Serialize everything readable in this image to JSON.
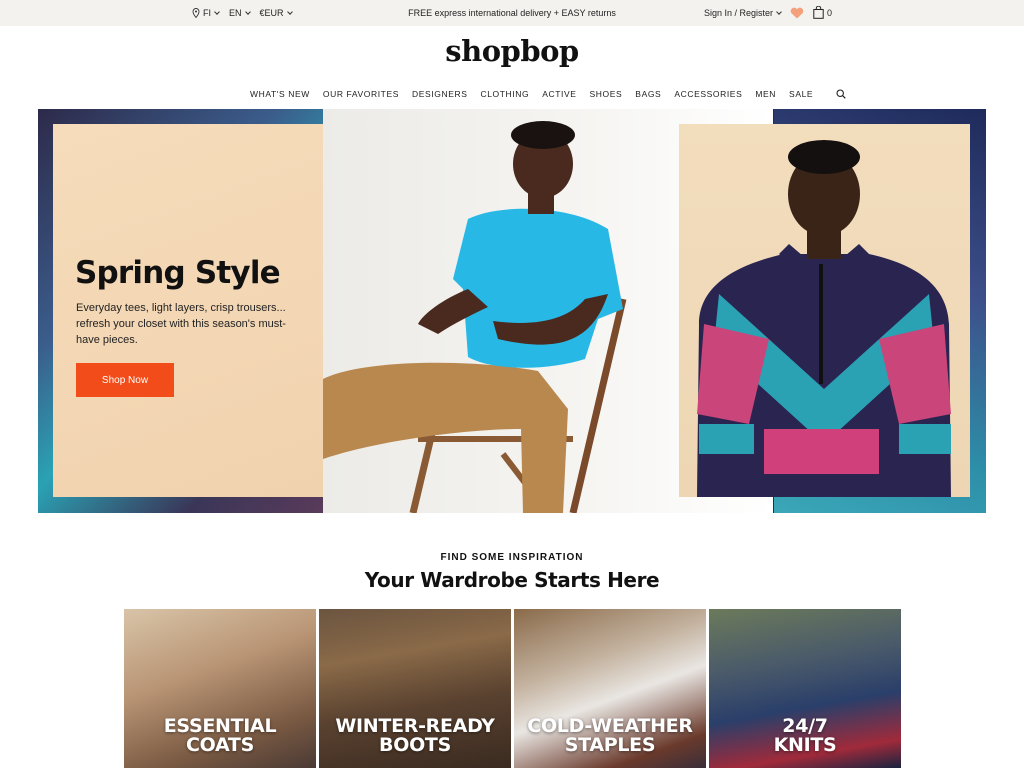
{
  "topbar": {
    "country": "FI",
    "language": "EN",
    "currency": "€EUR",
    "promo": "FREE express international delivery + EASY returns",
    "signin": "Sign In / Register",
    "bag_count": "0"
  },
  "logo": "shopbop",
  "nav": [
    "WHAT'S NEW",
    "OUR FAVORITES",
    "DESIGNERS",
    "CLOTHING",
    "ACTIVE",
    "SHOES",
    "BAGS",
    "ACCESSORIES",
    "MEN",
    "SALE"
  ],
  "hero": {
    "title": "Spring Style",
    "description": "Everyday tees, light layers, crisp trousers... refresh your closet with this season's must-have pieces.",
    "cta": "Shop Now"
  },
  "inspiration": {
    "eyebrow": "FIND SOME INSPIRATION",
    "title": "Your Wardrobe Starts Here"
  },
  "tiles": [
    {
      "line1": "ESSENTIAL",
      "line2": "COATS"
    },
    {
      "line1": "WINTER-READY",
      "line2": "BOOTS"
    },
    {
      "line1": "COLD-WEATHER",
      "line2": "STAPLES"
    },
    {
      "line1": "24/7",
      "line2": "KNITS"
    }
  ],
  "colors": {
    "accent": "#f24c1a",
    "heart": "#f4a07a",
    "topbar_bg": "#f4f2ef",
    "promo_card_bg": "#f6dcbb"
  },
  "icons": [
    "location-pin-icon",
    "chevron-down-icon",
    "heart-icon",
    "shopping-bag-icon",
    "search-icon"
  ]
}
